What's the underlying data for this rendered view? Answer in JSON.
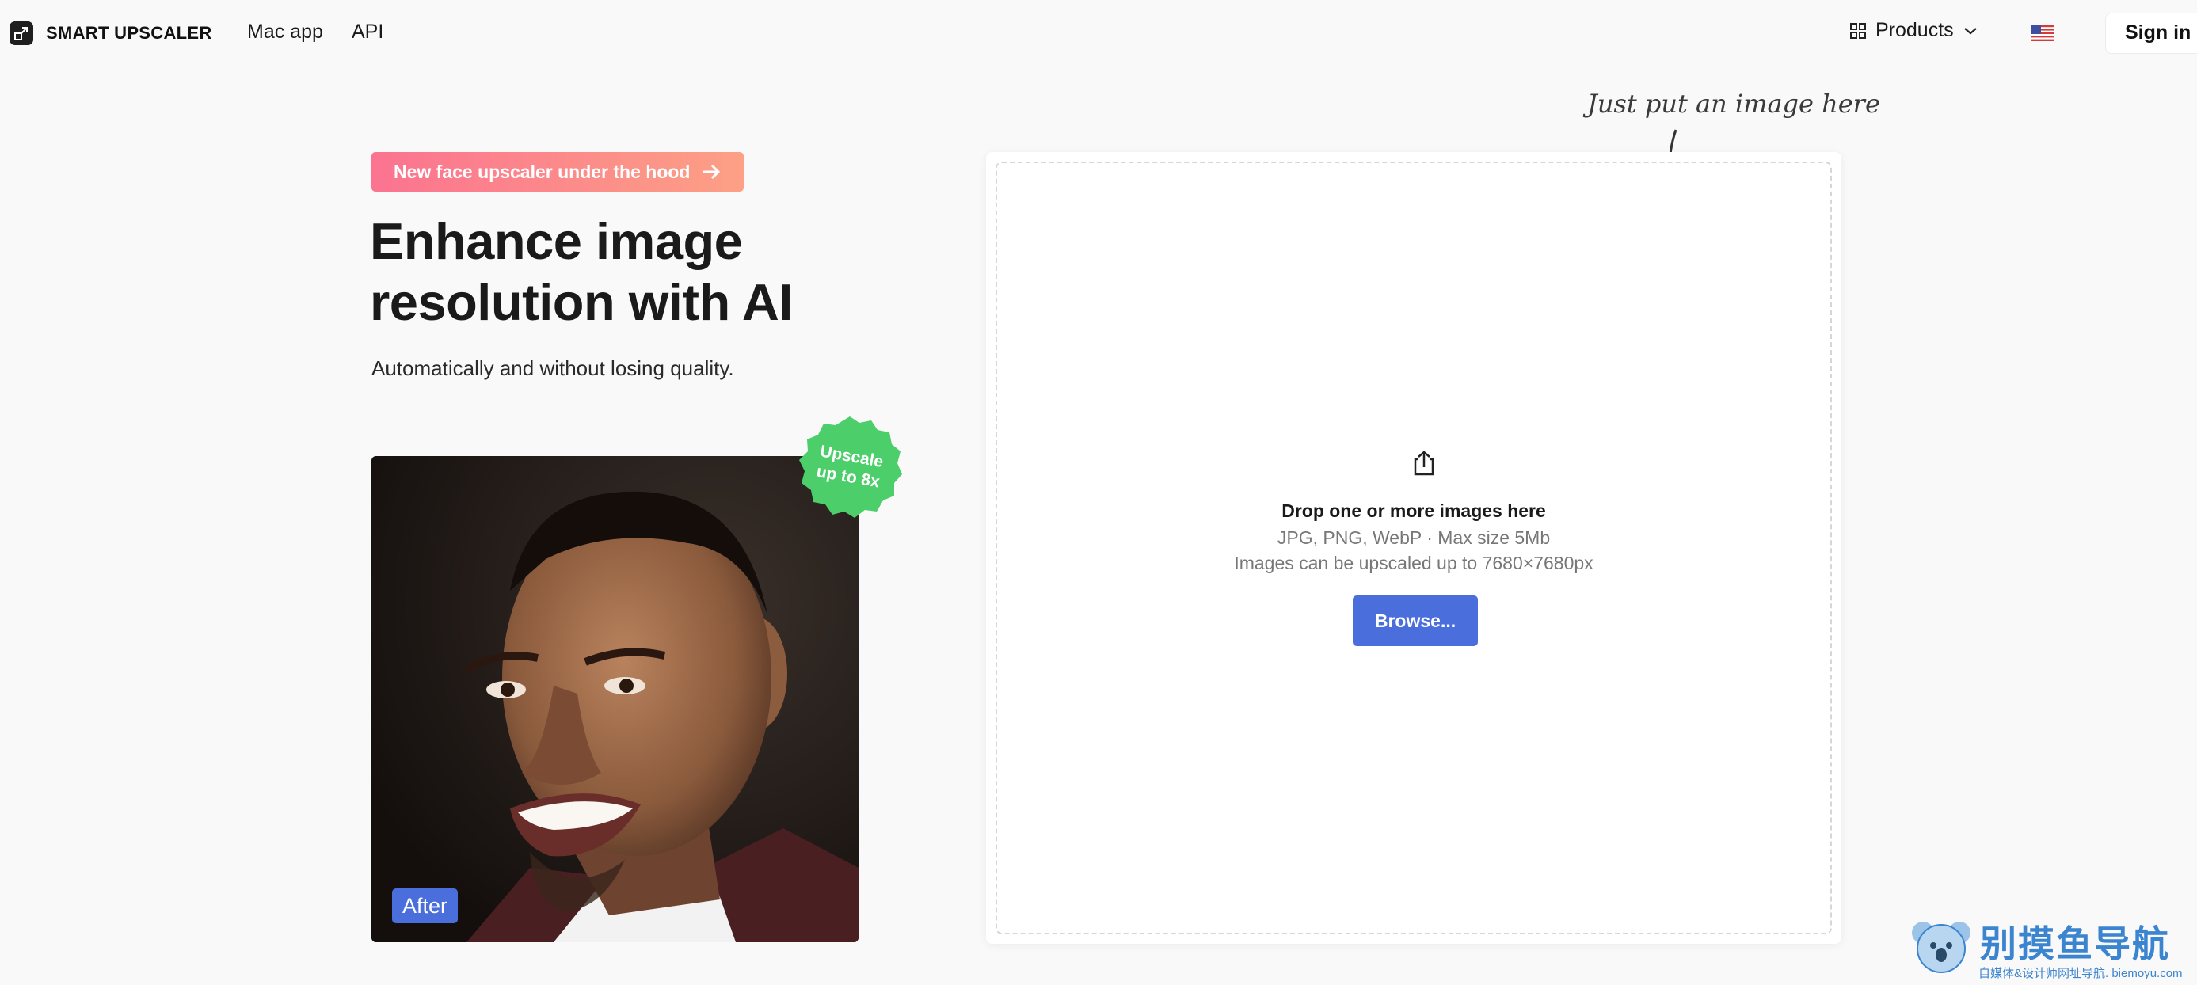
{
  "header": {
    "brand": "SMART UPSCALER",
    "nav": [
      "Mac app",
      "API"
    ],
    "products_label": "Products",
    "sign_in": "Sign in",
    "language_icon": "us-flag-icon"
  },
  "hero": {
    "announcement": "New face upscaler under the hood",
    "headline_line1": "Enhance image",
    "headline_line2": "resolution with AI",
    "subheadline": "Automatically and without losing quality.",
    "badge_line1": "Upscale",
    "badge_line2": "up to 8x",
    "image_tag": "After"
  },
  "upload": {
    "hint": "Just put an image here",
    "title": "Drop one or more images here",
    "formats": "JPG, PNG, WebP · Max size 5Mb",
    "limit": "Images can be upscaled up to 7680×7680px",
    "browse_label": "Browse..."
  },
  "watermark": {
    "title": "别摸鱼导航",
    "subtitle": "自媒体&设计师网址导航. biemoyu.com"
  },
  "colors": {
    "accent": "#4a6fdc",
    "badge": "#4cce6b",
    "pill_start": "#fb7390",
    "pill_end": "#fda085"
  }
}
